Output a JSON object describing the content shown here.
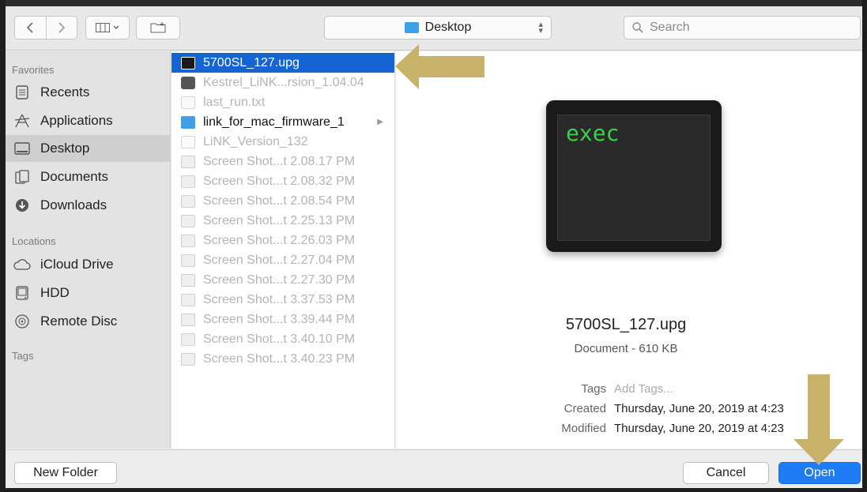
{
  "toolbar": {
    "location": "Desktop",
    "search_placeholder": "Search"
  },
  "sidebar": {
    "favorites_heading": "Favorites",
    "favorites": [
      {
        "label": "Recents",
        "icon": "recents-icon"
      },
      {
        "label": "Applications",
        "icon": "applications-icon"
      },
      {
        "label": "Desktop",
        "icon": "desktop-icon",
        "selected": true
      },
      {
        "label": "Documents",
        "icon": "documents-icon"
      },
      {
        "label": "Downloads",
        "icon": "downloads-icon"
      }
    ],
    "locations_heading": "Locations",
    "locations": [
      {
        "label": "iCloud Drive",
        "icon": "cloud-icon"
      },
      {
        "label": "HDD",
        "icon": "disk-icon"
      },
      {
        "label": "Remote Disc",
        "icon": "disc-icon"
      }
    ],
    "tags_heading": "Tags"
  },
  "files": [
    {
      "name": "5700SL_127.upg",
      "icon": "exec-file-icon",
      "selected": true
    },
    {
      "name": "Kestrel_LiNK...rsion_1.04.04",
      "icon": "app-icon"
    },
    {
      "name": "last_run.txt",
      "icon": "text-file-icon"
    },
    {
      "name": "link_for_mac_firmware_1",
      "icon": "folder-icon",
      "is_folder": true
    },
    {
      "name": "LiNK_Version_132",
      "icon": "document-icon"
    },
    {
      "name": "Screen Shot...t 2.08.17 PM",
      "icon": "image-file-icon"
    },
    {
      "name": "Screen Shot...t 2.08.32 PM",
      "icon": "image-file-icon"
    },
    {
      "name": "Screen Shot...t 2.08.54 PM",
      "icon": "image-file-icon"
    },
    {
      "name": "Screen Shot...t 2.25.13 PM",
      "icon": "image-file-icon"
    },
    {
      "name": "Screen Shot...t 2.26.03 PM",
      "icon": "image-file-icon"
    },
    {
      "name": "Screen Shot...t 2.27.04 PM",
      "icon": "image-file-icon"
    },
    {
      "name": "Screen Shot...t 2.27.30 PM",
      "icon": "image-file-icon"
    },
    {
      "name": "Screen Shot...t 3.37.53 PM",
      "icon": "image-file-icon"
    },
    {
      "name": "Screen Shot...t 3.39.44 PM",
      "icon": "image-file-icon"
    },
    {
      "name": "Screen Shot...t 3.40.10 PM",
      "icon": "image-file-icon"
    },
    {
      "name": "Screen Shot...t 3.40.23 PM",
      "icon": "image-file-icon"
    }
  ],
  "preview": {
    "icon_text": "exec",
    "file_name": "5700SL_127.upg",
    "kind_size": "Document - 610 KB",
    "tags_label": "Tags",
    "tags_placeholder": "Add Tags...",
    "created_label": "Created",
    "created_value": "Thursday, June 20, 2019 at 4:23",
    "modified_label": "Modified",
    "modified_value": "Thursday, June 20, 2019 at 4:23"
  },
  "buttons": {
    "new_folder": "New Folder",
    "cancel": "Cancel",
    "open": "Open"
  },
  "colors": {
    "selection": "#1464d4",
    "open_button": "#1f7cf5",
    "annotation_arrow": "#c8b26a",
    "exec_text": "#38d24a"
  }
}
